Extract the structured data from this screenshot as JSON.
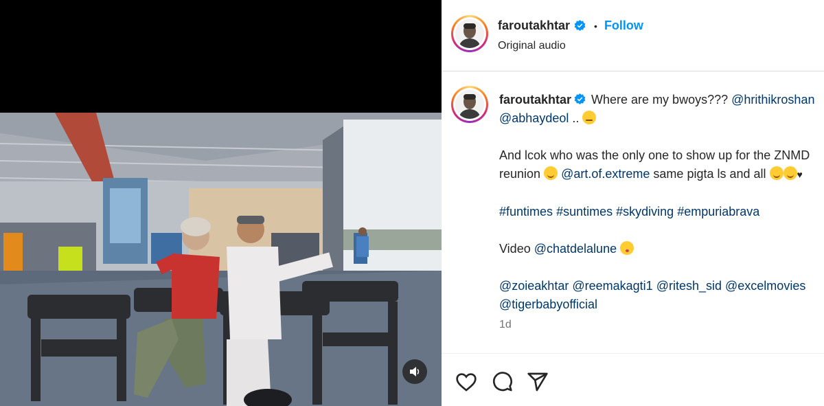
{
  "post": {
    "username": "faroutakhtar",
    "verified": true,
    "separator": "•",
    "follow_label": "Follow",
    "audio_label": "Original audio",
    "caption": {
      "line1_text": "Where are my bwoys???",
      "mention_hrithik": "@hrithikroshan",
      "mention_abhay": "@abhaydeol",
      "ellipsis": "..",
      "para2_text": "And lcok who was the only one to show up for the ZNMD reunion",
      "mention_extreme": "@art.of.extreme",
      "para2_tail": "same pigta ls and all",
      "heart": "♥",
      "hashtags": [
        "#funtimes",
        "#suntimes",
        "#skydiving",
        "#empuriabrava"
      ],
      "video_label": "Video",
      "mention_video": "@chatdelalune",
      "tags": [
        "@zoieakhtar",
        "@reemakagti1",
        "@ritesh_sid",
        "@excelmovies",
        "@tigerbabyofficial"
      ]
    },
    "timestamp": "1d"
  },
  "icons": {
    "verified": "verified-badge-icon",
    "mute": "speaker-icon",
    "like": "heart-icon",
    "comment": "comment-icon",
    "share": "paper-plane-icon"
  },
  "colors": {
    "link": "#0095f6",
    "mention": "#00376b",
    "text": "#262626",
    "muted": "#737373"
  }
}
